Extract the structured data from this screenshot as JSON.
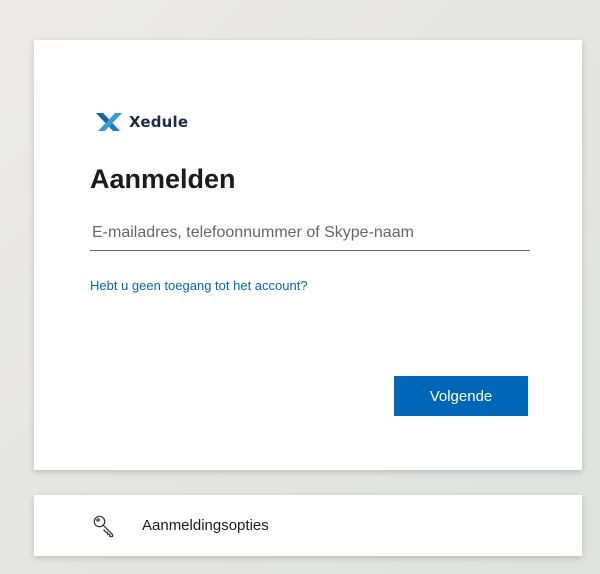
{
  "brand": {
    "name": "Xedule",
    "logo_icon": "xedule-x-logo-icon",
    "accent_color": "#0067b8"
  },
  "signin": {
    "title": "Aanmelden",
    "email_placeholder": "E-mailadres, telefoonnummer of Skype-naam",
    "email_value": "",
    "help_link": "Hebt u geen toegang tot het account?",
    "next_button": "Volgende"
  },
  "options": {
    "icon": "key-icon",
    "label": "Aanmeldingsopties"
  }
}
